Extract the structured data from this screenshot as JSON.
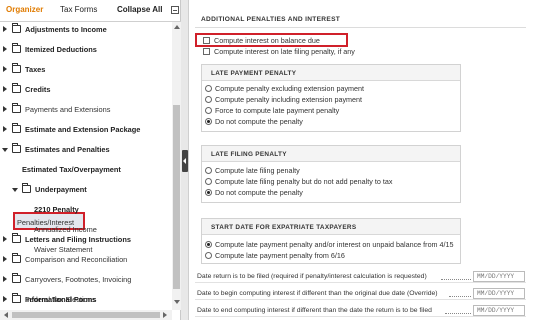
{
  "sidebar": {
    "tabs": {
      "organizer": "Organizer",
      "tax_forms": "Tax Forms"
    },
    "collapse_all": "Collapse All",
    "items": [
      {
        "label": "Adjustments to Income",
        "bold": true
      },
      {
        "label": "Itemized Deductions",
        "bold": true
      },
      {
        "label": "Taxes",
        "bold": true
      },
      {
        "label": "Credits",
        "bold": true
      },
      {
        "label": "Payments and Extensions",
        "bold": false
      },
      {
        "label": "Estimate and Extension Package",
        "bold": true
      },
      {
        "label": "Estimates and Penalties",
        "bold": true,
        "expanded": true
      },
      {
        "label": "Estimated Tax/Overpayment",
        "bold": true
      },
      {
        "label": "Underpayment",
        "bold": true,
        "expanded": true
      },
      {
        "label": "2210 Penalty",
        "bold": true
      },
      {
        "label": "Annualized Income",
        "bold": false
      },
      {
        "label": "Waiver Statement",
        "bold": false
      },
      {
        "label": "Penalties/Interest",
        "bold": false,
        "selected": true
      },
      {
        "label": "Letters and Filing Instructions",
        "bold": true
      },
      {
        "label": "Comparison and Reconciliation",
        "bold": false
      },
      {
        "label": "Carryovers, Footnotes, Invoicing",
        "bold": false
      },
      {
        "label": "Federal Tax Elections",
        "bold": false
      },
      {
        "label": "Informational Forms",
        "bold": true
      }
    ]
  },
  "main": {
    "section_title": "ADDITIONAL PENALTIES AND INTEREST",
    "top_checkboxes": [
      {
        "label": "Compute interest on balance due",
        "checked": false
      },
      {
        "label": "Compute interest on late filing penalty, if any",
        "checked": false
      }
    ],
    "late_payment": {
      "title": "LATE PAYMENT PENALTY",
      "options": [
        {
          "label": "Compute penalty excluding extension payment",
          "selected": false
        },
        {
          "label": "Compute penalty including extension payment",
          "selected": false
        },
        {
          "label": "Force to compute late payment penalty",
          "selected": false
        },
        {
          "label": "Do not compute the penalty",
          "selected": true
        }
      ]
    },
    "late_filing": {
      "title": "LATE FILING PENALTY",
      "options": [
        {
          "label": "Compute late filing penalty",
          "selected": false
        },
        {
          "label": "Compute late filing penalty but do not add penalty to tax",
          "selected": false
        },
        {
          "label": "Do not compute the penalty",
          "selected": true
        }
      ]
    },
    "expatriate": {
      "title": "START DATE FOR EXPATRIATE TAXPAYERS",
      "options": [
        {
          "label": "Compute late payment penalty and/or interest on unpaid balance from 4/15",
          "selected": true
        },
        {
          "label": "Compute late payment penalty from 6/16",
          "selected": false
        }
      ]
    },
    "date_fields": [
      {
        "label": "Date return is to be filed (required if penalty/interest calculation is requested)",
        "placeholder": "MM/DD/YYYY"
      },
      {
        "label": "Date to begin computing interest if different than the original due date (Override)",
        "placeholder": "MM/DD/YYYY"
      },
      {
        "label": "Date to end computing interest if different than the date the return is to be filed",
        "placeholder": "MM/DD/YYYY"
      }
    ]
  },
  "colors": {
    "accent_orange": "#e07b00",
    "highlight_red": "#d0202a",
    "selected_bg": "#e4e7ee"
  }
}
